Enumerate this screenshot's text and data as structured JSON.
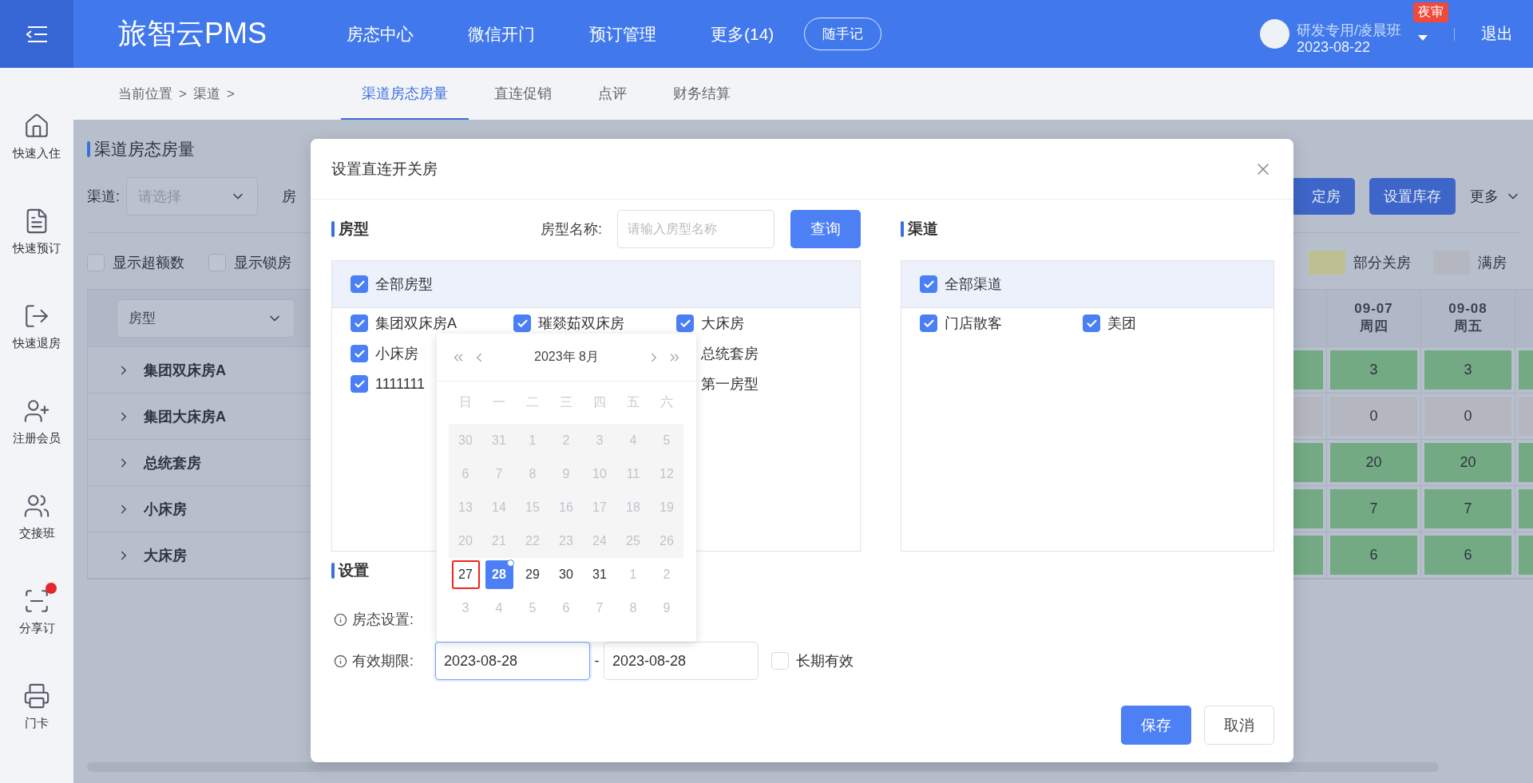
{
  "header": {
    "logo": "旅智云PMS",
    "nav": [
      {
        "label": "房态中心"
      },
      {
        "label": "微信开门"
      },
      {
        "label": "预订管理"
      },
      {
        "label": "更多(14)"
      }
    ],
    "note_button": "随手记",
    "user": {
      "name": "研发专用/凌晨班",
      "date": "2023-08-22",
      "badge": "夜审"
    },
    "logout": "退出"
  },
  "sidebar": {
    "items": [
      {
        "label": "快速入住",
        "kind": "checkin",
        "dot": false
      },
      {
        "label": "快速预订",
        "kind": "booking",
        "dot": false
      },
      {
        "label": "快速退房",
        "kind": "checkout",
        "dot": false
      },
      {
        "label": "注册会员",
        "kind": "member",
        "dot": false
      },
      {
        "label": "交接班",
        "kind": "shift",
        "dot": false
      },
      {
        "label": "分享订",
        "kind": "share",
        "dot": true
      },
      {
        "label": "门卡",
        "kind": "card",
        "dot": false
      }
    ]
  },
  "subnav": {
    "breadcrumb": [
      {
        "label": "当前位置",
        "separator": ">"
      },
      {
        "label": "渠道",
        "separator": ">"
      }
    ],
    "tabs": [
      {
        "label": "渠道房态房量",
        "selected": true
      },
      {
        "label": "直连促销",
        "selected": false
      },
      {
        "label": "点评",
        "selected": false
      },
      {
        "label": "财务结算",
        "selected": false
      }
    ]
  },
  "page": {
    "title": "渠道房态房量",
    "channel_label": "渠道:",
    "channel_placeholder": "请选择",
    "room_label": "房",
    "actions": [
      {
        "label": "定房",
        "kind": "primary"
      },
      {
        "label": "设置库存",
        "kind": "primary"
      },
      {
        "label": "更多",
        "kind": "menu"
      }
    ],
    "options": [
      {
        "label": "显示超额数",
        "checked": false
      },
      {
        "label": "显示锁房",
        "checked": false
      }
    ],
    "legend": [
      {
        "label": "部分关房",
        "color": "#bfc092"
      },
      {
        "label": "满房",
        "color": "#b4b7bf"
      }
    ],
    "table": {
      "type_filter": "房型",
      "columns": [
        {},
        {
          "date": "09-07",
          "day": "周四"
        },
        {
          "date": "09-08",
          "day": "周五"
        },
        {}
      ],
      "rows": [
        {
          "name": "集团双床房A",
          "expanded": false,
          "cells": [
            {
              "color": "#73aa83"
            },
            {
              "color": "#73aa83",
              "value": "3"
            },
            {
              "color": "#73aa83",
              "value": "3"
            },
            {
              "color": "#73aa83"
            }
          ]
        },
        {
          "name": "集团大床房A",
          "expanded": false,
          "cells": [
            {
              "color": "#b4b7bf"
            },
            {
              "color": "#b4b7bf",
              "value": "0"
            },
            {
              "color": "#b4b7bf",
              "value": "0"
            },
            {
              "color": "#b4b7bf"
            }
          ]
        },
        {
          "name": "总统套房",
          "expanded": false,
          "cells": [
            {
              "color": "#73aa83"
            },
            {
              "color": "#73aa83",
              "value": "20"
            },
            {
              "color": "#73aa83",
              "value": "20"
            },
            {
              "color": "#73aa83"
            }
          ]
        },
        {
          "name": "小床房",
          "expanded": false,
          "cells": [
            {
              "color": "#73aa83"
            },
            {
              "color": "#73aa83",
              "value": "7"
            },
            {
              "color": "#73aa83",
              "value": "7"
            },
            {
              "color": "#73aa83"
            }
          ]
        },
        {
          "name": "大床房",
          "expanded": false,
          "cells": [
            {
              "color": "#73aa83"
            },
            {
              "color": "#73aa83",
              "value": "6"
            },
            {
              "color": "#73aa83",
              "value": "6"
            },
            {
              "color": "#73aa83"
            }
          ]
        }
      ]
    }
  },
  "modal": {
    "title": "设置直连开关房",
    "room_types": {
      "heading": "房型",
      "search_label": "房型名称:",
      "search_placeholder": "请输入房型名称",
      "search_button": "查询",
      "all": {
        "label": "全部房型",
        "checked": true
      },
      "rows": [
        {
          "left": {
            "label": "集团双床房A",
            "checked": true
          },
          "middle": {
            "label": "璀燚茹双床房",
            "checked": true
          },
          "right": {
            "label": "大床房",
            "checked": true
          }
        },
        {
          "left": {
            "label": "小床房",
            "checked": true
          },
          "right": {
            "label": "总统套房"
          }
        },
        {
          "left": {
            "label": "1111111",
            "checked": true
          },
          "right": {
            "label": "第一房型"
          }
        }
      ]
    },
    "channels": {
      "heading": "渠道",
      "all": {
        "label": "全部渠道",
        "checked": true
      },
      "rows": [
        {
          "left": {
            "label": "门店散客",
            "checked": true
          },
          "middle": {
            "label": "美团",
            "checked": true
          }
        }
      ]
    },
    "settings": {
      "heading": "设置",
      "status_label": "房态设置:",
      "period_label": "有效期限:",
      "start": "2023-08-28",
      "separator": "-",
      "end": "2023-08-28",
      "long_term": {
        "label": "长期有效",
        "checked": false
      }
    },
    "buttons": [
      {
        "label": "保存",
        "kind": "primary"
      },
      {
        "label": "取消",
        "kind": "default"
      }
    ],
    "calendar": {
      "title": "2023年 8月",
      "weekdays": [
        "日",
        "一",
        "二",
        "三",
        "四",
        "五",
        "六"
      ],
      "weeks": [
        [
          {
            "label": "30",
            "kind": "disabled",
            "selected": false,
            "marked": false,
            "today": false
          },
          {
            "label": "31",
            "kind": "disabled",
            "selected": false,
            "marked": false,
            "today": false
          },
          {
            "label": "1",
            "kind": "disabled",
            "selected": false,
            "marked": false,
            "today": false
          },
          {
            "label": "2",
            "kind": "disabled",
            "selected": false,
            "marked": false,
            "today": false
          },
          {
            "label": "3",
            "kind": "disabled",
            "selected": false,
            "marked": false,
            "today": false
          },
          {
            "label": "4",
            "kind": "disabled",
            "selected": false,
            "marked": false,
            "today": false
          },
          {
            "label": "5",
            "kind": "disabled",
            "selected": false,
            "marked": false,
            "today": false
          }
        ],
        [
          {
            "label": "6",
            "kind": "disabled",
            "selected": false,
            "marked": false,
            "today": false
          },
          {
            "label": "7",
            "kind": "disabled",
            "selected": false,
            "marked": false,
            "today": false
          },
          {
            "label": "8",
            "kind": "disabled",
            "selected": false,
            "marked": false,
            "today": false
          },
          {
            "label": "9",
            "kind": "disabled",
            "selected": false,
            "marked": false,
            "today": false
          },
          {
            "label": "10",
            "kind": "disabled",
            "selected": false,
            "marked": false,
            "today": false
          },
          {
            "label": "11",
            "kind": "disabled",
            "selected": false,
            "marked": false,
            "today": false
          },
          {
            "label": "12",
            "kind": "disabled",
            "selected": false,
            "marked": false,
            "today": false
          }
        ],
        [
          {
            "label": "13",
            "kind": "disabled",
            "selected": false,
            "marked": false,
            "today": false
          },
          {
            "label": "14",
            "kind": "disabled",
            "selected": false,
            "marked": false,
            "today": false
          },
          {
            "label": "15",
            "kind": "disabled",
            "selected": false,
            "marked": false,
            "today": false
          },
          {
            "label": "16",
            "kind": "disabled",
            "selected": false,
            "marked": false,
            "today": false
          },
          {
            "label": "17",
            "kind": "disabled",
            "selected": false,
            "marked": false,
            "today": false
          },
          {
            "label": "18",
            "kind": "disabled",
            "selected": false,
            "marked": false,
            "today": false
          },
          {
            "label": "19",
            "kind": "disabled",
            "selected": false,
            "marked": false,
            "today": false
          }
        ],
        [
          {
            "label": "20",
            "kind": "disabled",
            "selected": false,
            "marked": false,
            "today": false
          },
          {
            "label": "21",
            "kind": "disabled",
            "selected": false,
            "marked": false,
            "today": false
          },
          {
            "label": "22",
            "kind": "disabled",
            "selected": false,
            "marked": false,
            "today": false
          },
          {
            "label": "23",
            "kind": "disabled",
            "selected": false,
            "marked": false,
            "today": false
          },
          {
            "label": "24",
            "kind": "disabled",
            "selected": false,
            "marked": false,
            "today": false
          },
          {
            "label": "25",
            "kind": "disabled",
            "selected": false,
            "marked": false,
            "today": false
          },
          {
            "label": "26",
            "kind": "disabled",
            "selected": false,
            "marked": false,
            "today": false
          }
        ],
        [
          {
            "label": "27",
            "kind": "normal",
            "selected": false,
            "marked": true,
            "today": false
          },
          {
            "label": "28",
            "kind": "normal",
            "selected": true,
            "marked": false,
            "today": true
          },
          {
            "label": "29",
            "kind": "normal",
            "selected": false,
            "marked": false,
            "today": false
          },
          {
            "label": "30",
            "kind": "normal",
            "selected": false,
            "marked": false,
            "today": false
          },
          {
            "label": "31",
            "kind": "normal",
            "selected": false,
            "marked": false,
            "today": false
          },
          {
            "label": "1",
            "kind": "outside",
            "selected": false,
            "marked": false,
            "today": false
          },
          {
            "label": "2",
            "kind": "outside",
            "selected": false,
            "marked": false,
            "today": false
          }
        ],
        [
          {
            "label": "3",
            "kind": "outside",
            "selected": false,
            "marked": false,
            "today": false
          },
          {
            "label": "4",
            "kind": "outside",
            "selected": false,
            "marked": false,
            "today": false
          },
          {
            "label": "5",
            "kind": "outside",
            "selected": false,
            "marked": false,
            "today": false
          },
          {
            "label": "6",
            "kind": "outside",
            "selected": false,
            "marked": false,
            "today": false
          },
          {
            "label": "7",
            "kind": "outside",
            "selected": false,
            "marked": false,
            "today": false
          },
          {
            "label": "8",
            "kind": "outside",
            "selected": false,
            "marked": false,
            "today": false
          },
          {
            "label": "9",
            "kind": "outside",
            "selected": false,
            "marked": false,
            "today": false
          }
        ]
      ]
    }
  }
}
